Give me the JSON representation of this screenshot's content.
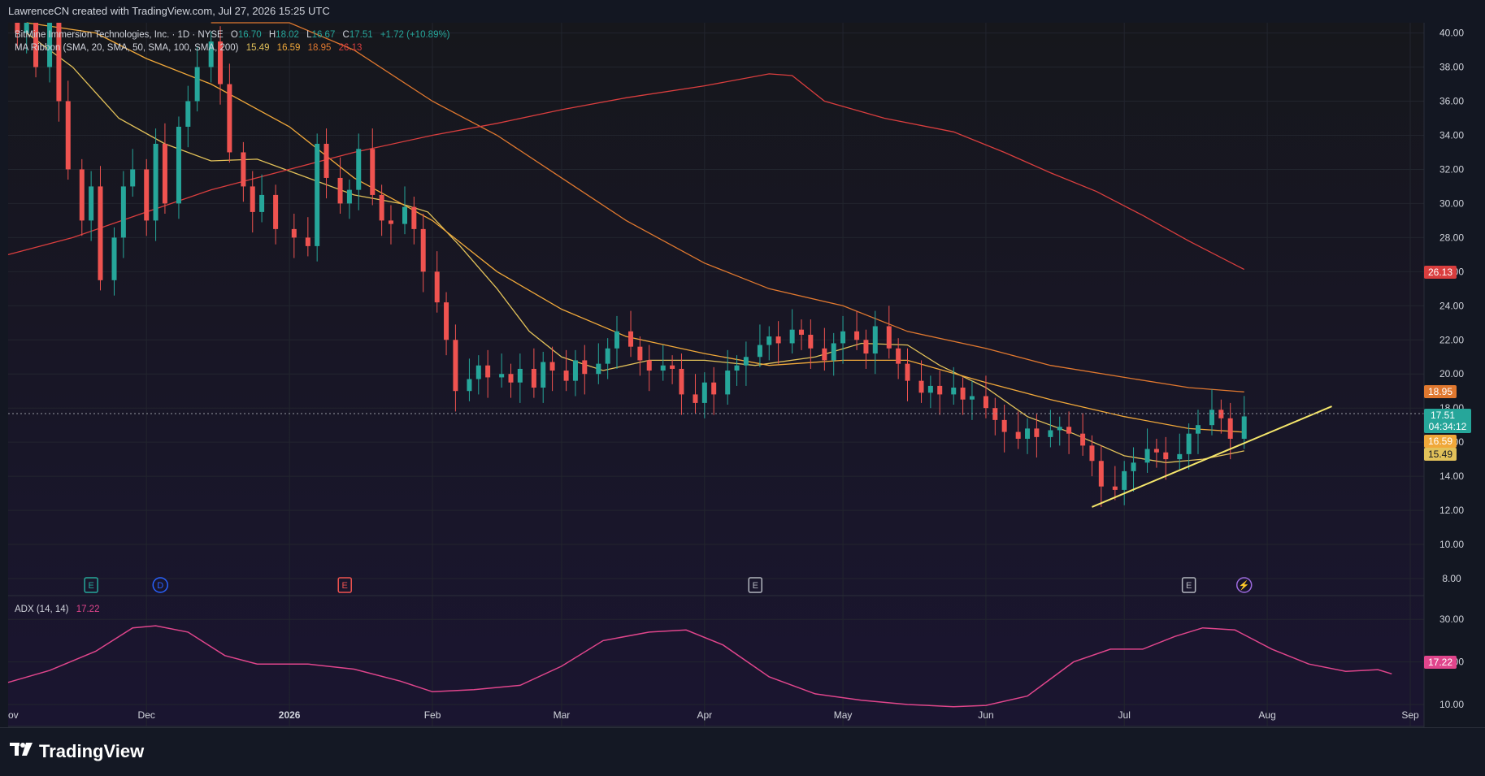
{
  "header": {
    "attribution": "LawrenceCN created with TradingView.com, Jul 27, 2026 15:25 UTC"
  },
  "legend": {
    "symbol": "BitMine Immersion Technologies, Inc. · 1D · NYSE",
    "open_label": "O",
    "open": "16.70",
    "high_label": "H",
    "high": "18.02",
    "low_label": "L",
    "low": "16.67",
    "close_label": "C",
    "close": "17.51",
    "change": "+1.72 (+10.89%)",
    "ma_label": "MA Ribbon (SMA, 20, SMA, 50, SMA, 100, SMA, 200)",
    "ma20": "15.49",
    "ma50": "16.59",
    "ma100": "18.95",
    "ma200": "26.13"
  },
  "adx_legend": {
    "label": "ADX (14, 14)",
    "value": "17.22"
  },
  "price_badges": {
    "ma200": "26.13",
    "ma100": "18.95",
    "last": "17.51",
    "countdown": "04:34:12",
    "ma50": "16.59",
    "ma20": "15.49",
    "adx": "17.22"
  },
  "colors": {
    "background": "#131722",
    "up": "#26a69a",
    "down": "#ef5350",
    "ma20": "#e2c159",
    "ma50": "#f0a83a",
    "ma100": "#e0782f",
    "ma200": "#d93e3e",
    "trendline": "#f5e66b",
    "adx": "#e0458c"
  },
  "events": [
    {
      "label": "E",
      "date": "2025-11-19",
      "color": "#26a69a"
    },
    {
      "label": "D",
      "date": "2025-12-04",
      "color": "#2962ff"
    },
    {
      "label": "E",
      "date": "2026-01-13",
      "color": "#ef5350"
    },
    {
      "label": "E",
      "date": "2026-04-12",
      "color": "#b2b5be"
    },
    {
      "label": "E",
      "date": "2026-07-15",
      "color": "#b2b5be"
    },
    {
      "label": "⚡",
      "date": "2026-07-27",
      "color": "#9c6ade"
    }
  ],
  "footer": {
    "brand": "TradingView"
  },
  "chart_data": {
    "type": "candlestick",
    "title": "BitMine Immersion Technologies, Inc. · 1D · NYSE",
    "x_ticks": [
      "Dec",
      "2026",
      "Feb",
      "Mar",
      "Apr",
      "May",
      "Jun",
      "Jul",
      "Aug",
      "Sep"
    ],
    "x_tick_dates": [
      "2025-12-01",
      "2026-01-01",
      "2026-02-01",
      "2026-03-01",
      "2026-04-01",
      "2026-05-01",
      "2026-06-01",
      "2026-07-01",
      "2026-08-01",
      "2026-09-01"
    ],
    "x_first_partial_label": "ov",
    "x_range": [
      "2025-11-01",
      "2026-09-01"
    ],
    "y_ticks": [
      "8.00",
      "10.00",
      "12.00",
      "14.00",
      "16.00",
      "18.00",
      "20.00",
      "22.00",
      "24.00",
      "26.00",
      "28.00",
      "30.00",
      "32.00",
      "34.00",
      "36.00",
      "38.00",
      "40.00"
    ],
    "ylim": [
      7,
      40.6
    ],
    "close_path": [
      [
        "2025-11-03",
        40
      ],
      [
        "2025-11-05",
        41.5
      ],
      [
        "2025-11-07",
        38
      ],
      [
        "2025-11-10",
        41
      ],
      [
        "2025-11-12",
        36
      ],
      [
        "2025-11-14",
        32
      ],
      [
        "2025-11-17",
        29
      ],
      [
        "2025-11-19",
        31
      ],
      [
        "2025-11-21",
        25.5
      ],
      [
        "2025-11-24",
        28
      ],
      [
        "2025-11-26",
        31
      ],
      [
        "2025-11-28",
        32
      ],
      [
        "2025-12-01",
        29
      ],
      [
        "2025-12-03",
        33.5
      ],
      [
        "2025-12-05",
        30
      ],
      [
        "2025-12-08",
        34.5
      ],
      [
        "2025-12-10",
        36
      ],
      [
        "2025-12-12",
        38
      ],
      [
        "2025-12-15",
        39.5
      ],
      [
        "2025-12-17",
        37
      ],
      [
        "2025-12-19",
        33
      ],
      [
        "2025-12-22",
        31
      ],
      [
        "2025-12-24",
        29.5
      ],
      [
        "2025-12-26",
        30.5
      ],
      [
        "2025-12-29",
        28.5
      ],
      [
        "2026-01-02",
        28
      ],
      [
        "2026-01-05",
        27.5
      ],
      [
        "2026-01-07",
        33.5
      ],
      [
        "2026-01-09",
        31.5
      ],
      [
        "2026-01-12",
        30
      ],
      [
        "2026-01-14",
        30.8
      ],
      [
        "2026-01-16",
        33.2
      ],
      [
        "2026-01-19",
        30.5
      ],
      [
        "2026-01-21",
        29
      ],
      [
        "2026-01-23",
        28.8
      ],
      [
        "2026-01-26",
        29.8
      ],
      [
        "2026-01-28",
        28.5
      ],
      [
        "2026-01-30",
        26
      ],
      [
        "2026-02-02",
        24.2
      ],
      [
        "2026-02-04",
        22
      ],
      [
        "2026-02-06",
        19
      ],
      [
        "2026-02-09",
        19.7
      ],
      [
        "2026-02-11",
        20.5
      ],
      [
        "2026-02-13",
        19.8
      ],
      [
        "2026-02-16",
        20
      ],
      [
        "2026-02-18",
        19.5
      ],
      [
        "2026-02-20",
        20.3
      ],
      [
        "2026-02-23",
        19.2
      ],
      [
        "2026-02-25",
        20.7
      ],
      [
        "2026-02-27",
        20.2
      ],
      [
        "2026-03-02",
        19.6
      ],
      [
        "2026-03-04",
        20.8
      ],
      [
        "2026-03-06",
        20
      ],
      [
        "2026-03-09",
        20.6
      ],
      [
        "2026-03-11",
        21.5
      ],
      [
        "2026-03-13",
        22.5
      ],
      [
        "2026-03-16",
        21.6
      ],
      [
        "2026-03-18",
        20.8
      ],
      [
        "2026-03-20",
        20.2
      ],
      [
        "2026-03-23",
        20.5
      ],
      [
        "2026-03-25",
        20.3
      ],
      [
        "2026-03-27",
        18.8
      ],
      [
        "2026-03-30",
        18.3
      ],
      [
        "2026-04-01",
        19.5
      ],
      [
        "2026-04-03",
        18.8
      ],
      [
        "2026-04-06",
        20.2
      ],
      [
        "2026-04-08",
        20.5
      ],
      [
        "2026-04-10",
        21
      ],
      [
        "2026-04-13",
        21.7
      ],
      [
        "2026-04-15",
        22.2
      ],
      [
        "2026-04-17",
        21.8
      ],
      [
        "2026-04-20",
        22.6
      ],
      [
        "2026-04-22",
        22.3
      ],
      [
        "2026-04-24",
        21.5
      ],
      [
        "2026-04-27",
        20.8
      ],
      [
        "2026-04-29",
        21.8
      ],
      [
        "2026-05-01",
        22.5
      ],
      [
        "2026-05-04",
        22
      ],
      [
        "2026-05-06",
        21.2
      ],
      [
        "2026-05-08",
        22.8
      ],
      [
        "2026-05-11",
        21.5
      ],
      [
        "2026-05-13",
        20.6
      ],
      [
        "2026-05-15",
        19.6
      ],
      [
        "2026-05-18",
        18.9
      ],
      [
        "2026-05-20",
        19.3
      ],
      [
        "2026-05-22",
        18.8
      ],
      [
        "2026-05-25",
        19.2
      ],
      [
        "2026-05-27",
        18.5
      ],
      [
        "2026-05-29",
        18.7
      ],
      [
        "2026-06-01",
        18
      ],
      [
        "2026-06-03",
        17.3
      ],
      [
        "2026-06-05",
        16.6
      ],
      [
        "2026-06-08",
        16.2
      ],
      [
        "2026-06-10",
        16.8
      ],
      [
        "2026-06-12",
        16.3
      ],
      [
        "2026-06-15",
        16.7
      ],
      [
        "2026-06-17",
        16.9
      ],
      [
        "2026-06-19",
        16.5
      ],
      [
        "2026-06-22",
        15.8
      ],
      [
        "2026-06-24",
        14.9
      ],
      [
        "2026-06-26",
        13.4
      ],
      [
        "2026-06-29",
        13.2
      ],
      [
        "2026-07-01",
        14.3
      ],
      [
        "2026-07-03",
        14.8
      ],
      [
        "2026-07-06",
        15.6
      ],
      [
        "2026-07-08",
        15.4
      ],
      [
        "2026-07-10",
        15
      ],
      [
        "2026-07-13",
        15.3
      ],
      [
        "2026-07-15",
        16.5
      ],
      [
        "2026-07-17",
        17
      ],
      [
        "2026-07-20",
        17.9
      ],
      [
        "2026-07-22",
        17.4
      ],
      [
        "2026-07-24",
        16.2
      ],
      [
        "2026-07-27",
        17.51
      ]
    ],
    "series": [
      {
        "name": "SMA 20",
        "values": [
          [
            "2025-11-05",
            40
          ],
          [
            "2025-11-15",
            38
          ],
          [
            "2025-11-25",
            35
          ],
          [
            "2025-12-05",
            33.5
          ],
          [
            "2025-12-15",
            32.5
          ],
          [
            "2025-12-25",
            32.6
          ],
          [
            "2026-01-05",
            31.5
          ],
          [
            "2026-01-15",
            30.5
          ],
          [
            "2026-01-25",
            30
          ],
          [
            "2026-01-31",
            29.5
          ],
          [
            "2026-02-07",
            27.5
          ],
          [
            "2026-02-15",
            25
          ],
          [
            "2026-02-22",
            22.5
          ],
          [
            "2026-03-01",
            21
          ],
          [
            "2026-03-10",
            20.2
          ],
          [
            "2026-03-20",
            20.8
          ],
          [
            "2026-04-01",
            20.8
          ],
          [
            "2026-04-12",
            20.5
          ],
          [
            "2026-04-25",
            21
          ],
          [
            "2026-05-05",
            21.8
          ],
          [
            "2026-05-15",
            21.7
          ],
          [
            "2026-05-22",
            20.5
          ],
          [
            "2026-06-01",
            19.2
          ],
          [
            "2026-06-10",
            17.5
          ],
          [
            "2026-06-20",
            16.5
          ],
          [
            "2026-07-01",
            15.2
          ],
          [
            "2026-07-10",
            14.8
          ],
          [
            "2026-07-18",
            15
          ],
          [
            "2026-07-27",
            15.49
          ]
        ]
      },
      {
        "name": "SMA 50",
        "values": [
          [
            "2025-11-05",
            41.5
          ],
          [
            "2025-11-20",
            40
          ],
          [
            "2025-12-01",
            38.5
          ],
          [
            "2025-12-15",
            37
          ],
          [
            "2026-01-01",
            34.5
          ],
          [
            "2026-01-15",
            31.5
          ],
          [
            "2026-02-01",
            29
          ],
          [
            "2026-02-15",
            26
          ],
          [
            "2026-03-01",
            23.8
          ],
          [
            "2026-03-15",
            22.2
          ],
          [
            "2026-04-01",
            21.2
          ],
          [
            "2026-04-15",
            20.5
          ],
          [
            "2026-05-01",
            20.8
          ],
          [
            "2026-05-15",
            20.8
          ],
          [
            "2026-06-01",
            19.5
          ],
          [
            "2026-06-15",
            18.5
          ],
          [
            "2026-07-01",
            17.5
          ],
          [
            "2026-07-15",
            16.8
          ],
          [
            "2026-07-27",
            16.59
          ]
        ]
      },
      {
        "name": "SMA 100",
        "values": [
          [
            "2025-12-15",
            41.5
          ],
          [
            "2026-01-01",
            41
          ],
          [
            "2026-01-15",
            39
          ],
          [
            "2026-02-01",
            36
          ],
          [
            "2026-02-15",
            34
          ],
          [
            "2026-03-01",
            31.5
          ],
          [
            "2026-03-15",
            29
          ],
          [
            "2026-04-01",
            26.5
          ],
          [
            "2026-04-15",
            25
          ],
          [
            "2026-05-01",
            24
          ],
          [
            "2026-05-15",
            22.5
          ],
          [
            "2026-06-01",
            21.5
          ],
          [
            "2026-06-15",
            20.5
          ],
          [
            "2026-07-01",
            19.8
          ],
          [
            "2026-07-15",
            19.2
          ],
          [
            "2026-07-27",
            18.95
          ]
        ]
      },
      {
        "name": "SMA 200",
        "values": [
          [
            "2025-11-01",
            27
          ],
          [
            "2025-11-15",
            28
          ],
          [
            "2025-12-01",
            29.5
          ],
          [
            "2025-12-15",
            30.8
          ],
          [
            "2026-01-01",
            32
          ],
          [
            "2026-01-15",
            33
          ],
          [
            "2026-02-01",
            34
          ],
          [
            "2026-02-15",
            34.7
          ],
          [
            "2026-03-01",
            35.5
          ],
          [
            "2026-03-15",
            36.2
          ],
          [
            "2026-04-01",
            36.9
          ],
          [
            "2026-04-15",
            37.6
          ],
          [
            "2026-04-20",
            37.5
          ],
          [
            "2026-04-27",
            36
          ],
          [
            "2026-05-10",
            35
          ],
          [
            "2026-05-25",
            34.2
          ],
          [
            "2026-06-05",
            33
          ],
          [
            "2026-06-15",
            31.8
          ],
          [
            "2026-06-25",
            30.7
          ],
          [
            "2026-07-05",
            29.3
          ],
          [
            "2026-07-15",
            27.8
          ],
          [
            "2026-07-27",
            26.13
          ]
        ]
      },
      {
        "name": "Trendline",
        "values": [
          [
            "2026-06-24",
            12.2
          ],
          [
            "2026-08-15",
            18.1
          ]
        ]
      }
    ],
    "adx": {
      "name": "ADX (14, 14)",
      "y_ticks": [
        "10.00",
        "20.00",
        "30.00"
      ],
      "ylim": [
        6,
        35
      ],
      "values": [
        [
          "2025-11-01",
          15.2
        ],
        [
          "2025-11-10",
          18
        ],
        [
          "2025-11-20",
          22.5
        ],
        [
          "2025-11-28",
          28
        ],
        [
          "2025-12-03",
          28.5
        ],
        [
          "2025-12-10",
          27
        ],
        [
          "2025-12-18",
          21.5
        ],
        [
          "2025-12-25",
          19.5
        ],
        [
          "2026-01-05",
          19.5
        ],
        [
          "2026-01-15",
          18.3
        ],
        [
          "2026-01-25",
          15.5
        ],
        [
          "2026-02-01",
          13
        ],
        [
          "2026-02-10",
          13.5
        ],
        [
          "2026-02-20",
          14.5
        ],
        [
          "2026-03-01",
          19
        ],
        [
          "2026-03-10",
          25
        ],
        [
          "2026-03-20",
          27
        ],
        [
          "2026-03-28",
          27.5
        ],
        [
          "2026-04-05",
          24
        ],
        [
          "2026-04-15",
          16.5
        ],
        [
          "2026-04-25",
          12.5
        ],
        [
          "2026-05-05",
          11
        ],
        [
          "2026-05-15",
          10
        ],
        [
          "2026-05-25",
          9.5
        ],
        [
          "2026-06-01",
          9.8
        ],
        [
          "2026-06-10",
          12
        ],
        [
          "2026-06-20",
          20
        ],
        [
          "2026-06-28",
          23
        ],
        [
          "2026-07-05",
          23
        ],
        [
          "2026-07-12",
          26
        ],
        [
          "2026-07-18",
          28
        ],
        [
          "2026-07-25",
          27.5
        ],
        [
          "2026-08-02",
          23
        ],
        [
          "2026-08-10",
          19.5
        ],
        [
          "2026-08-18",
          17.8
        ],
        [
          "2026-08-25",
          18.2
        ],
        [
          "2026-08-28",
          17.2
        ]
      ]
    }
  }
}
